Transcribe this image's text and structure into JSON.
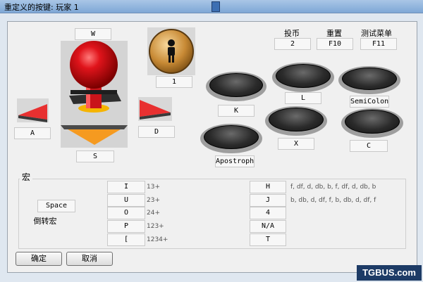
{
  "window": {
    "title": "重定义的按键: 玩家 1"
  },
  "joystick": {
    "up": "W",
    "left": "A",
    "right": "D",
    "down": "S",
    "center": "1"
  },
  "settings": [
    {
      "caption": "投币",
      "value": "2"
    },
    {
      "caption": "重置",
      "value": "F10"
    },
    {
      "caption": "测试菜单",
      "value": "F11"
    }
  ],
  "buttons": {
    "b1": "K",
    "b2": "L",
    "b3": "SemiColon",
    "b4": "Apostroph",
    "b5": "X",
    "b6": "C"
  },
  "macro": {
    "title": "宏",
    "reverse_key": "Space",
    "reverse_label": "倒转宏",
    "left": [
      {
        "key": "I",
        "seq": "13+"
      },
      {
        "key": "U",
        "seq": "23+"
      },
      {
        "key": "O",
        "seq": "24+"
      },
      {
        "key": "P",
        "seq": "123+"
      },
      {
        "key": "[",
        "seq": "1234+"
      }
    ],
    "right": [
      {
        "key": "H",
        "seq": "f, df, d, db, b, f, df, d, db, b"
      },
      {
        "key": "J",
        "seq": "b, db, d, df, f, b, db, d, df, f"
      },
      {
        "key": "4",
        "seq": ""
      },
      {
        "key": "N/A",
        "seq": ""
      },
      {
        "key": "T",
        "seq": ""
      }
    ]
  },
  "actions": {
    "ok": "确定",
    "cancel": "取消"
  },
  "watermark": "TGBUS.com",
  "colors": {
    "ball": "#e0141b",
    "arrow": "#e83030",
    "down_arrow": "#f59a20",
    "title_bar": "#8fb3de"
  }
}
